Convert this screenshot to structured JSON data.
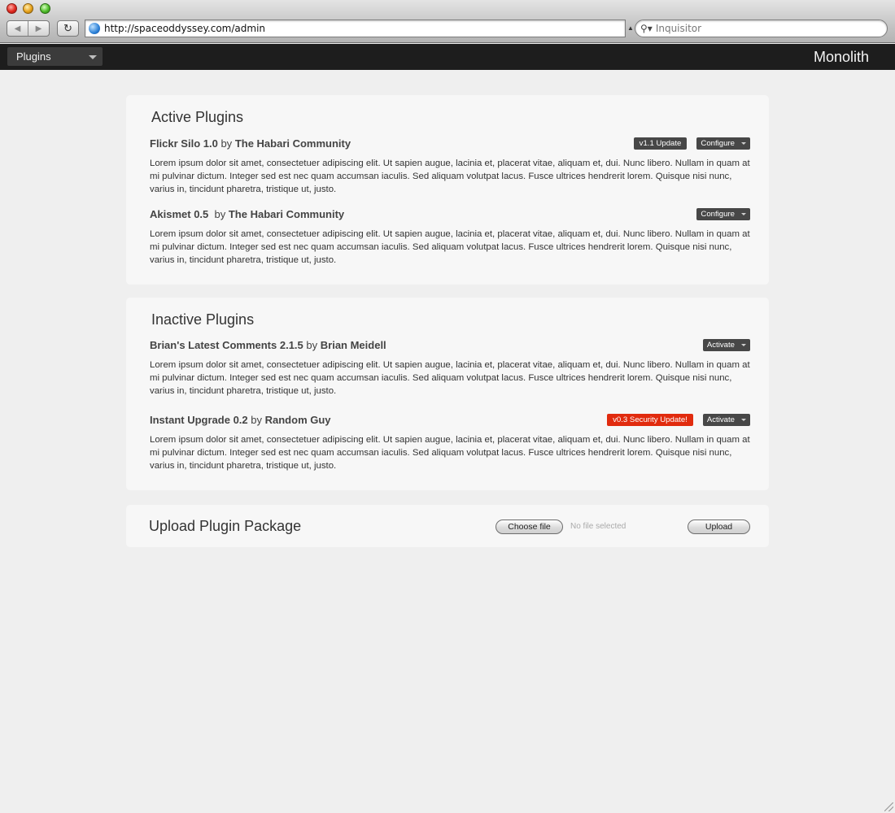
{
  "browser": {
    "url": "http://spaceoddyssey.com/admin",
    "search_placeholder": "Inquisitor",
    "back_glyph": "◀",
    "forward_glyph": "▶",
    "reload_glyph": "↻"
  },
  "topbar": {
    "menu_selected": "Plugins",
    "brand": "Monolith"
  },
  "active_section": {
    "title": "Active Plugins",
    "plugins": [
      {
        "name": "Flickr Silo 1.0",
        "by": "by",
        "author": "The Habari Community",
        "update_badge": "v1.1 Update",
        "action": "Configure",
        "description": "Lorem ipsum dolor sit amet, consectetuer adipiscing elit. Ut sapien augue, lacinia et, placerat vitae, aliquam et, dui. Nunc libero. Nullam in quam at mi pulvinar dictum. Integer sed est nec quam accumsan iaculis. Sed aliquam volutpat lacus. Fusce ultrices hendrerit lorem. Quisque nisi nunc, varius in, tincidunt pharetra, tristique ut, justo."
      },
      {
        "name": "Akismet 0.5",
        "by": "by",
        "author": "The Habari Community",
        "action": "Configure",
        "description": "Lorem ipsum dolor sit amet, consectetuer adipiscing elit. Ut sapien augue, lacinia et, placerat vitae, aliquam et, dui. Nunc libero. Nullam in quam at mi pulvinar dictum. Integer sed est nec quam accumsan iaculis. Sed aliquam volutpat lacus. Fusce ultrices hendrerit lorem. Quisque nisi nunc, varius in, tincidunt pharetra, tristique ut, justo."
      }
    ]
  },
  "inactive_section": {
    "title": "Inactive Plugins",
    "plugins": [
      {
        "name": "Brian's Latest Comments 2.1.5",
        "by": "by",
        "author": "Brian Meidell",
        "action": "Activate",
        "description": "Lorem ipsum dolor sit amet, consectetuer adipiscing elit. Ut sapien augue, lacinia et, placerat vitae, aliquam et, dui. Nunc libero. Nullam in quam at mi pulvinar dictum. Integer sed est nec quam accumsan iaculis. Sed aliquam volutpat lacus. Fusce ultrices hendrerit lorem. Quisque nisi nunc, varius in, tincidunt pharetra, tristique ut, justo."
      },
      {
        "name": "Instant Upgrade 0.2",
        "by": "by",
        "author": "Random Guy",
        "security_badge": "v0.3 Security Update!",
        "action": "Activate",
        "description": "Lorem ipsum dolor sit amet, consectetuer adipiscing elit. Ut sapien augue, lacinia et, placerat vitae, aliquam et, dui. Nunc libero. Nullam in quam at mi pulvinar dictum. Integer sed est nec quam accumsan iaculis. Sed aliquam volutpat lacus. Fusce ultrices hendrerit lorem. Quisque nisi nunc, varius in, tincidunt pharetra, tristique ut, justo."
      }
    ]
  },
  "upload": {
    "title": "Upload Plugin Package",
    "choose_label": "Choose file",
    "file_status": "No file selected",
    "upload_label": "Upload"
  },
  "colors": {
    "badge_dark": "#474747",
    "badge_security": "#e12b0e",
    "topbar_bg": "#1d1d1d",
    "page_bg": "#efefef",
    "panel_bg": "#f7f7f7"
  }
}
